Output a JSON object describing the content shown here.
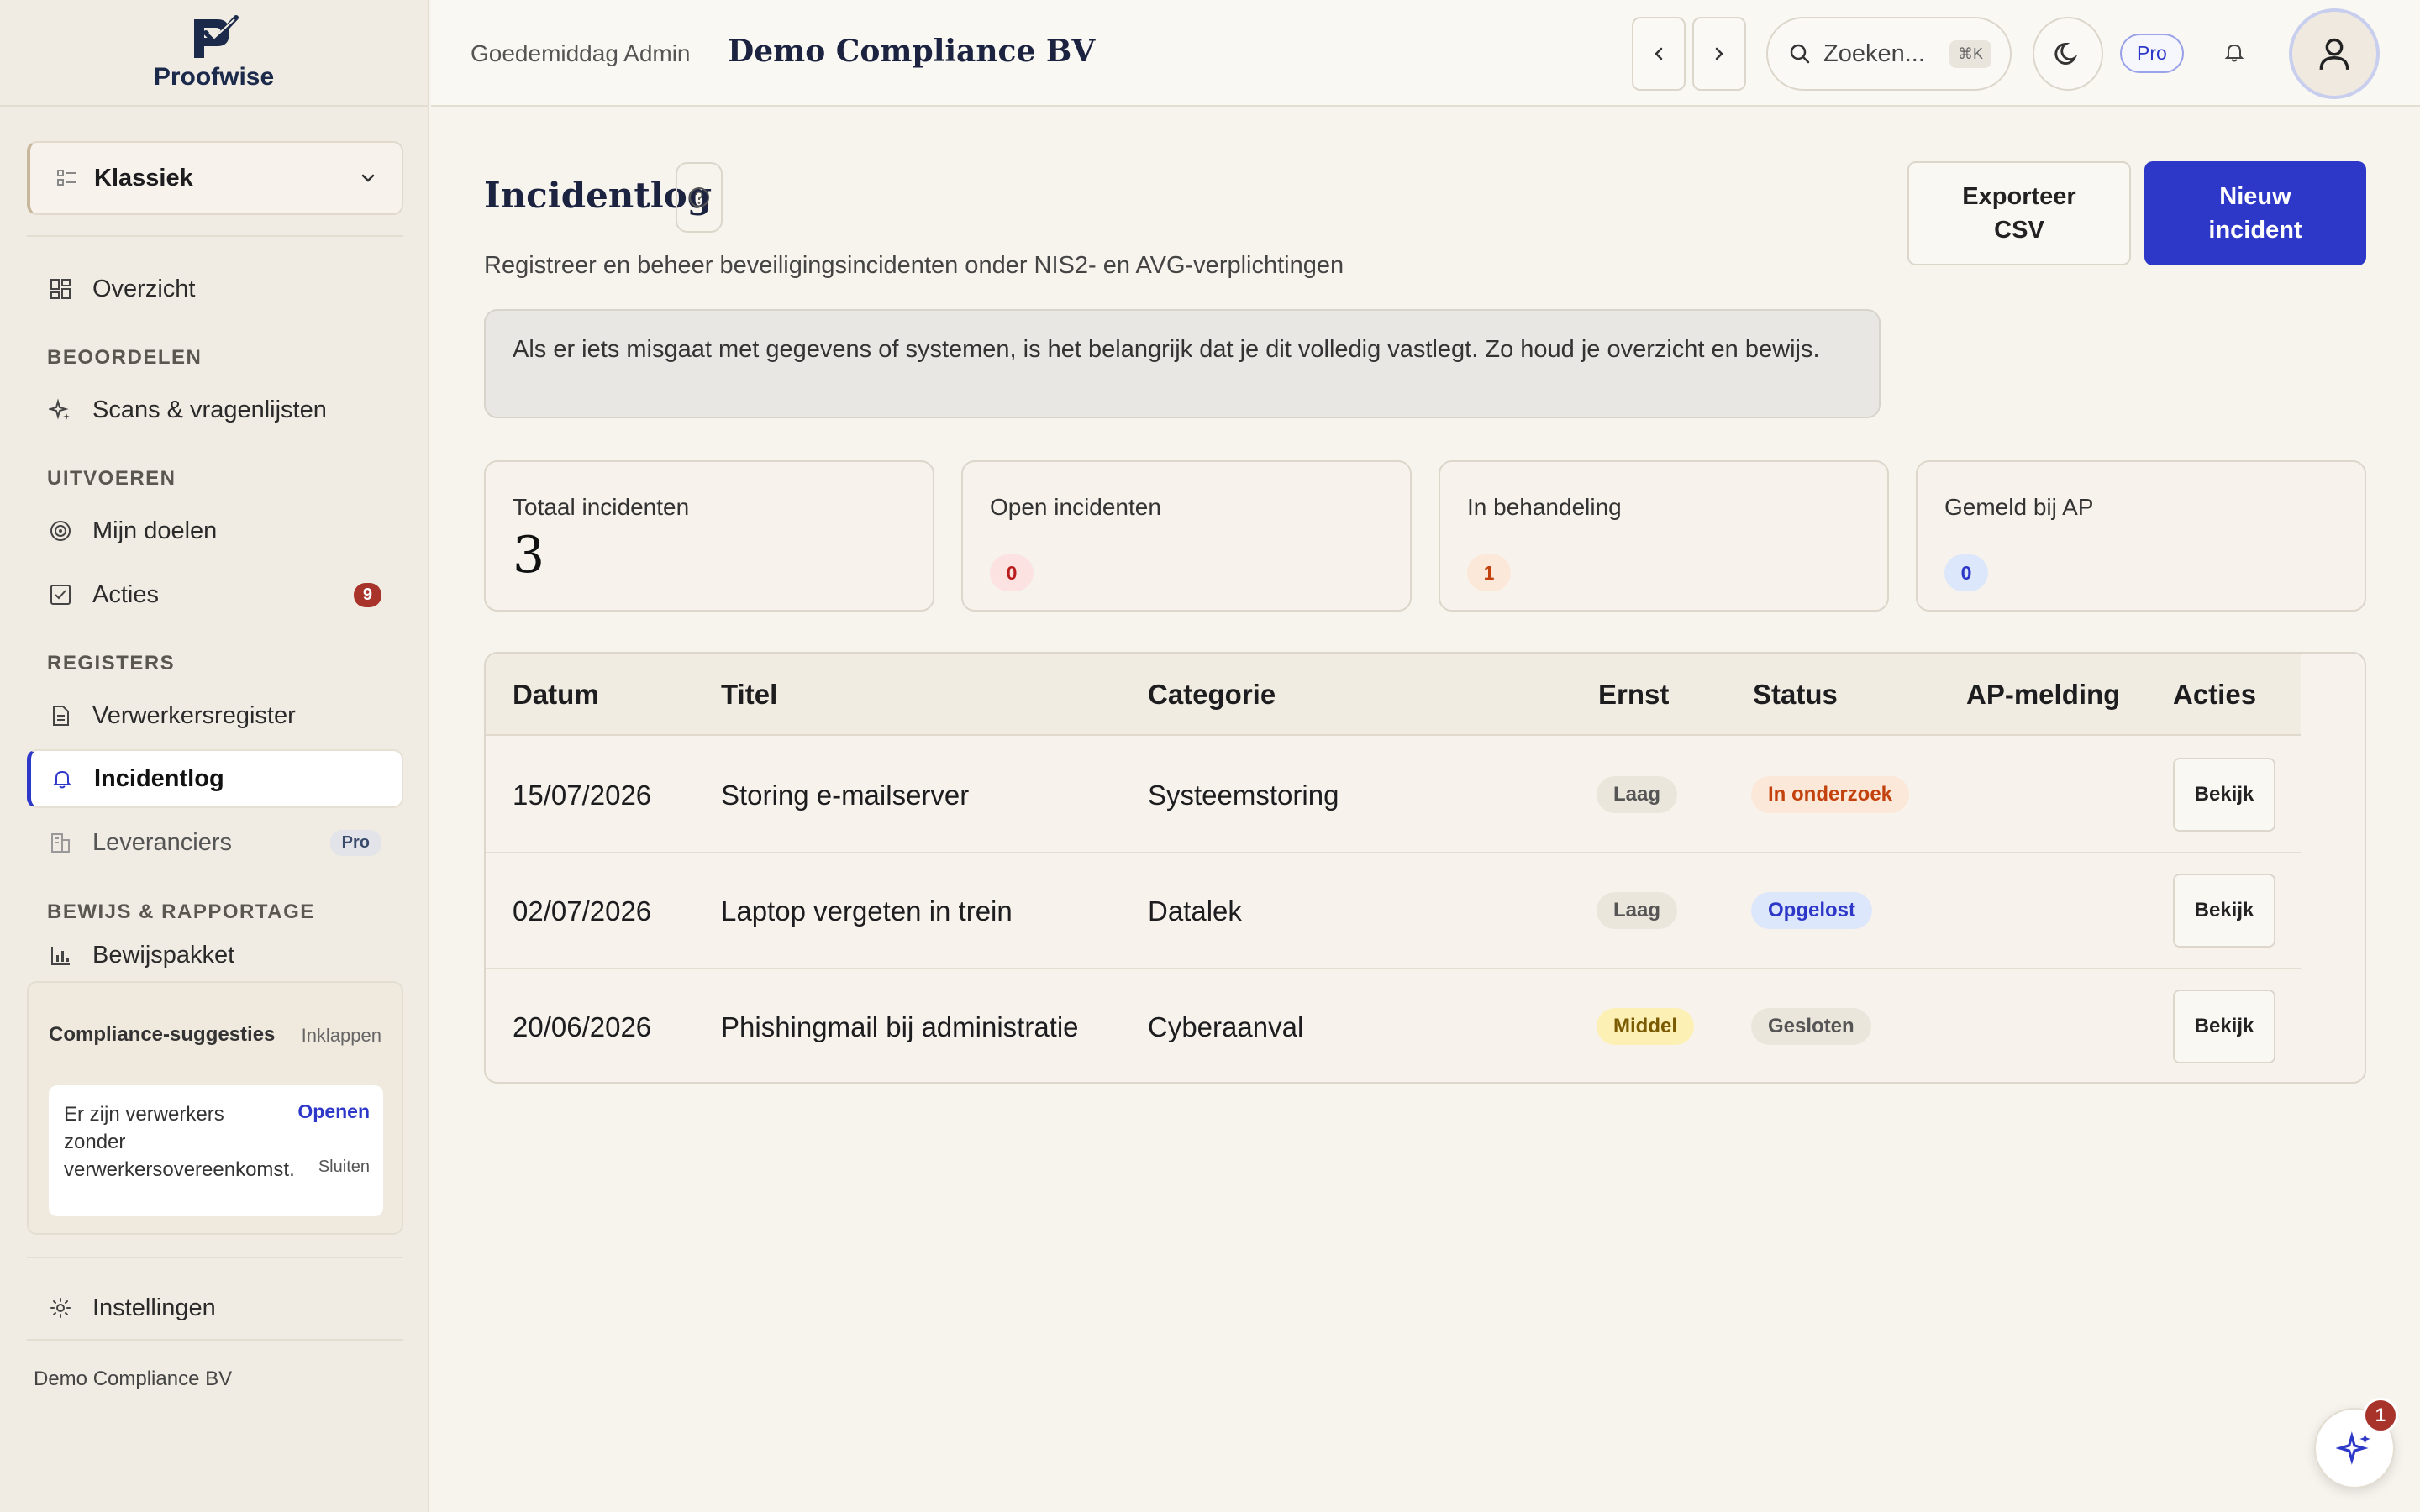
{
  "brand": {
    "name": "Proofwise"
  },
  "sidebar": {
    "view_selector": "Klassiek",
    "items": {
      "overview": "Overzicht",
      "scans": "Scans & vragenlijsten",
      "goals": "Mijn doelen",
      "actions": "Acties",
      "actions_badge": "9",
      "processors": "Verwerkersregister",
      "incidents": "Incidentlog",
      "suppliers": "Leveranciers",
      "suppliers_badge": "Pro",
      "evidence": "Bewijspakket",
      "settings": "Instellingen"
    },
    "sections": {
      "assess": "BEOORDELEN",
      "execute": "UITVOEREN",
      "registers": "REGISTERS",
      "evidence": "BEWIJS & RAPPORTAGE"
    },
    "suggestions": {
      "title": "Compliance-suggesties",
      "collapse": "Inklappen",
      "text": "Er zijn verwerkers zonder verwerkersovereenkomst.",
      "open": "Openen",
      "close": "Sluiten"
    },
    "footer_company": "Demo Compliance BV"
  },
  "topbar": {
    "greeting": "Goedemiddag Admin",
    "company": "Demo Compliance BV",
    "search_placeholder": "Zoeken...",
    "search_shortcut": "⌘K",
    "plan_badge": "Pro"
  },
  "page": {
    "title": "Incidentlog",
    "subtitle": "Registreer en beheer beveiligingsincidenten onder NIS2- en AVG-verplichtingen",
    "export_label": "Exporteer CSV",
    "new_label": "Nieuw incident",
    "info": "Als er iets misgaat met gegevens of systemen, is het belangrijk dat je dit volledig vastlegt. Zo houd je overzicht en bewijs."
  },
  "stats": {
    "total_label": "Totaal incidenten",
    "total_value": "3",
    "open_label": "Open incidenten",
    "open_value": "0",
    "progress_label": "In behandeling",
    "progress_value": "1",
    "reported_label": "Gemeld bij AP",
    "reported_value": "0"
  },
  "table": {
    "headers": {
      "date": "Datum",
      "title": "Titel",
      "category": "Categorie",
      "severity": "Ernst",
      "status": "Status",
      "ap": "AP-melding",
      "actions": "Acties"
    },
    "rows": [
      {
        "date": "15/07/2026",
        "title": "Storing e-mailserver",
        "category": "Systeemstoring",
        "severity": "Laag",
        "status": "In onderzoek",
        "action": "Bekijk"
      },
      {
        "date": "02/07/2026",
        "title": "Laptop vergeten in trein",
        "category": "Datalek",
        "severity": "Laag",
        "status": "Opgelost",
        "action": "Bekijk"
      },
      {
        "date": "20/06/2026",
        "title": "Phishingmail bij administratie",
        "category": "Cyberaanval",
        "severity": "Middel",
        "status": "Gesloten",
        "action": "Bekijk"
      }
    ]
  },
  "assistant": {
    "badge": "1"
  },
  "colors": {
    "accent": "#2d37c8",
    "danger": "#a8332b",
    "background": "#f7f4ee"
  }
}
